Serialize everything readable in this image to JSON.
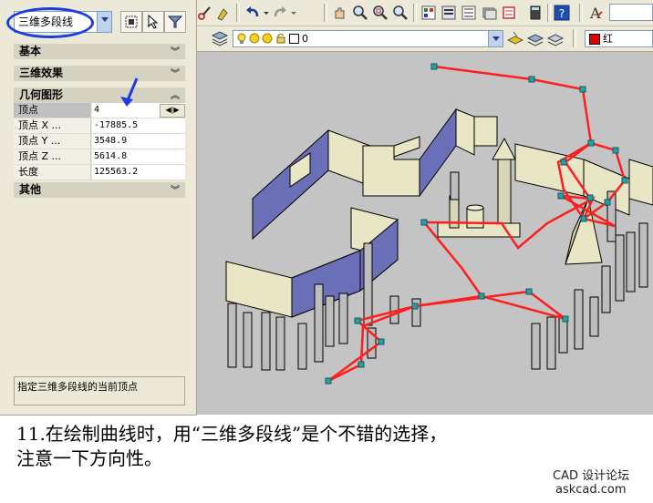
{
  "toolbar": {
    "layer_value": "0",
    "color_value": "红",
    "color_swatch": "#e00000",
    "icons": [
      "cut-icon",
      "match-properties-icon",
      "undo-icon",
      "redo-icon",
      "pan-icon",
      "zoom-realtime-icon",
      "zoom-window-icon",
      "zoom-previous-icon",
      "properties-icon",
      "design-center-icon",
      "tool-palettes-icon",
      "sheet-set-icon",
      "markup-icon",
      "quickcalc-icon",
      "help-icon",
      "text-style-icon"
    ]
  },
  "properties": {
    "object_type": "三维多段线",
    "categories": {
      "basic": "基本",
      "effects": "三维效果",
      "geometry": "几何图形",
      "other": "其他"
    },
    "rows": [
      {
        "key": "顶点",
        "value": "4"
      },
      {
        "key": "顶点 X ...",
        "value": "-17885.5"
      },
      {
        "key": "顶点 Y ...",
        "value": "3548.9"
      },
      {
        "key": "顶点 Z ...",
        "value": "5614.8"
      },
      {
        "key": "长度",
        "value": "125563.2"
      }
    ],
    "description": "指定三维多段线的当前顶点"
  },
  "caption": {
    "line1": "11.在绘制曲线时，用“三维多段线”是个不错的选择，",
    "line2": "注意一下方向性。"
  },
  "watermark": {
    "line1": "CAD 设计论坛",
    "line2": "askcad.com"
  },
  "colors": {
    "polyline": "#ff1e1e",
    "wall_face": "#e8e6c4",
    "wall_side": "#6a6fb8",
    "viewport_bg": "#c4c4c4",
    "annotation": "#1a3de0"
  }
}
